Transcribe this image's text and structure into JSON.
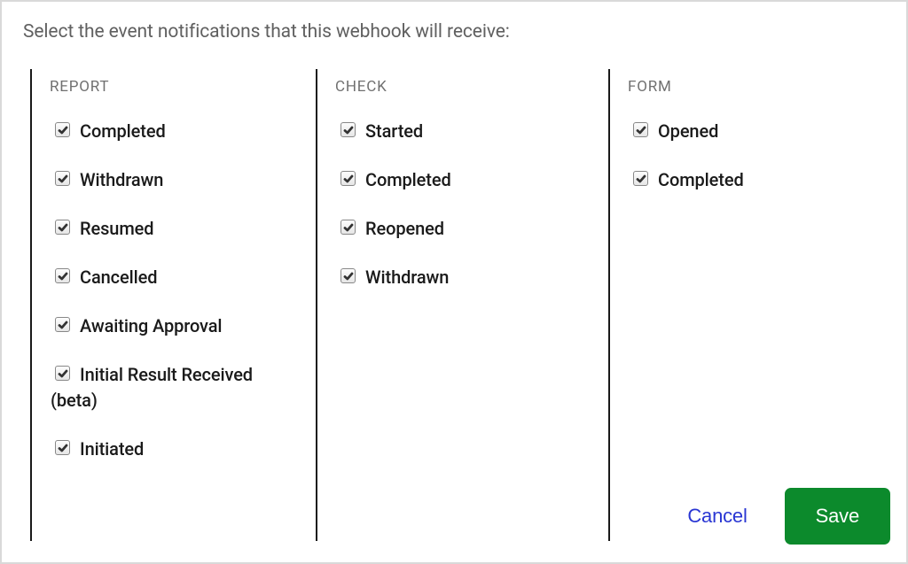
{
  "instruction": "Select the event notifications that this webhook will receive:",
  "columns": [
    {
      "header": "REPORT",
      "items": [
        {
          "label": "Completed",
          "checked": true
        },
        {
          "label": "Withdrawn",
          "checked": true
        },
        {
          "label": "Resumed",
          "checked": true
        },
        {
          "label": "Cancelled",
          "checked": true
        },
        {
          "label": "Awaiting Approval",
          "checked": true
        },
        {
          "label": "Initial Result Received (beta)",
          "checked": true
        },
        {
          "label": "Initiated",
          "checked": true
        }
      ]
    },
    {
      "header": "CHECK",
      "items": [
        {
          "label": "Started",
          "checked": true
        },
        {
          "label": "Completed",
          "checked": true
        },
        {
          "label": "Reopened",
          "checked": true
        },
        {
          "label": "Withdrawn",
          "checked": true
        }
      ]
    },
    {
      "header": "FORM",
      "items": [
        {
          "label": "Opened",
          "checked": true
        },
        {
          "label": "Completed",
          "checked": true
        }
      ]
    }
  ],
  "buttons": {
    "cancel": "Cancel",
    "save": "Save"
  }
}
